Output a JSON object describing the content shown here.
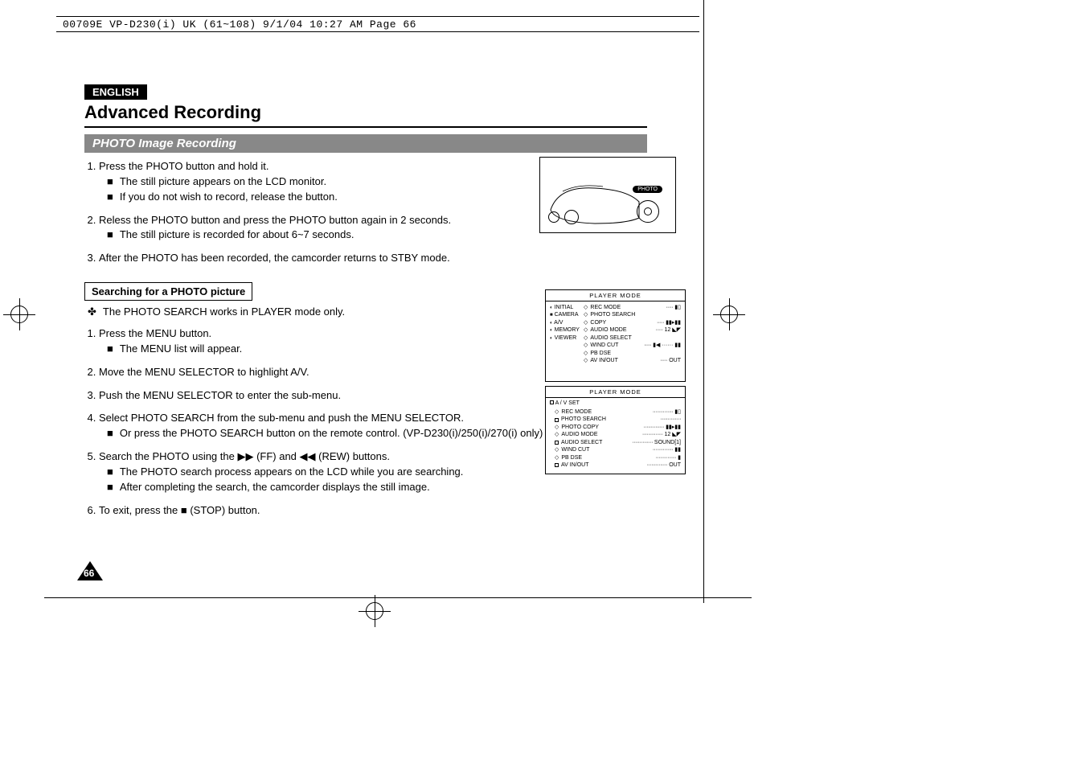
{
  "header_info": "00709E VP-D230(i) UK (61~108)  9/1/04 10:27 AM  Page 66",
  "lang": "ENGLISH",
  "section_title": "Advanced Recording",
  "sub_title": "PHOTO Image Recording",
  "steps_a": [
    {
      "num": "1.",
      "text": "Press the PHOTO button and hold it.",
      "subs": [
        "The still picture appears on the LCD monitor.",
        "If you do not wish to record, release the button."
      ]
    },
    {
      "num": "2.",
      "text": "Reless the PHOTO button and press the PHOTO button again in 2 seconds.",
      "subs": [
        "The still picture is recorded for about 6~7 seconds."
      ]
    },
    {
      "num": "3.",
      "text": "After the PHOTO has been recorded, the camcorder returns to STBY mode.",
      "subs": []
    }
  ],
  "sub_heading": "Searching for a PHOTO picture",
  "flower_point": "The PHOTO SEARCH works in PLAYER mode only.",
  "steps_b": [
    {
      "num": "1.",
      "text": "Press the MENU button.",
      "subs": [
        "The MENU list will appear."
      ]
    },
    {
      "num": "2.",
      "text": "Move the MENU SELECTOR to highlight A/V.",
      "subs": []
    },
    {
      "num": "3.",
      "text": "Push the MENU SELECTOR to enter the sub-menu.",
      "subs": []
    },
    {
      "num": "4.",
      "text": "Select PHOTO SEARCH from the sub-menu and push the MENU SELECTOR.",
      "subs": [
        "Or press the PHOTO SEARCH button on the remote control. (VP-D230(i)/250(i)/270(i) only)"
      ]
    },
    {
      "num": "5.",
      "text": "Search the PHOTO using the  ▶▶ (FF) and  ◀◀ (REW) buttons.",
      "subs": [
        "The PHOTO search process appears on the LCD while you are searching.",
        "After completing the search, the camcorder displays the still image."
      ]
    },
    {
      "num": "6.",
      "text": "To exit, press the  ■ (STOP) button.",
      "subs": []
    }
  ],
  "page_num": "66",
  "camcorder_label": "PHOTO",
  "menu1": {
    "title": "PLAYER  MODE",
    "left_items": [
      "INITIAL",
      "CAMERA",
      "A/V",
      "MEMORY",
      "VIEWER"
    ],
    "right_items": [
      {
        "l": "REC MODE",
        "r": "▮▯"
      },
      {
        "l": "PHOTO SEARCH",
        "r": ""
      },
      {
        "l": "COPY",
        "r": "▮▮▸▮▮"
      },
      {
        "l": "AUDIO MODE",
        "r": "12 ◣◤"
      },
      {
        "l": "AUDIO SELECT",
        "r": ""
      },
      {
        "l": "WIND CUT",
        "r": "▮◀ ······ ▮▮"
      },
      {
        "l": "PB DSE",
        "r": ""
      },
      {
        "l": "AV IN/OUT",
        "r": "OUT"
      }
    ]
  },
  "menu2": {
    "title": "PLAYER  MODE",
    "header": "A / V SET",
    "items": [
      {
        "l": "REC MODE",
        "r": "▮▯"
      },
      {
        "l": "PHOTO SEARCH",
        "r": ""
      },
      {
        "l": "PHOTO COPY",
        "r": "▮▮▸▮▮"
      },
      {
        "l": "AUDIO MODE",
        "r": "12 ◣◤"
      },
      {
        "l": "AUDIO SELECT",
        "r": "SOUND[1]"
      },
      {
        "l": "WIND CUT",
        "r": "▮▮"
      },
      {
        "l": "PB DSE",
        "r": "▮"
      },
      {
        "l": "AV IN/OUT",
        "r": "OUT"
      }
    ]
  }
}
